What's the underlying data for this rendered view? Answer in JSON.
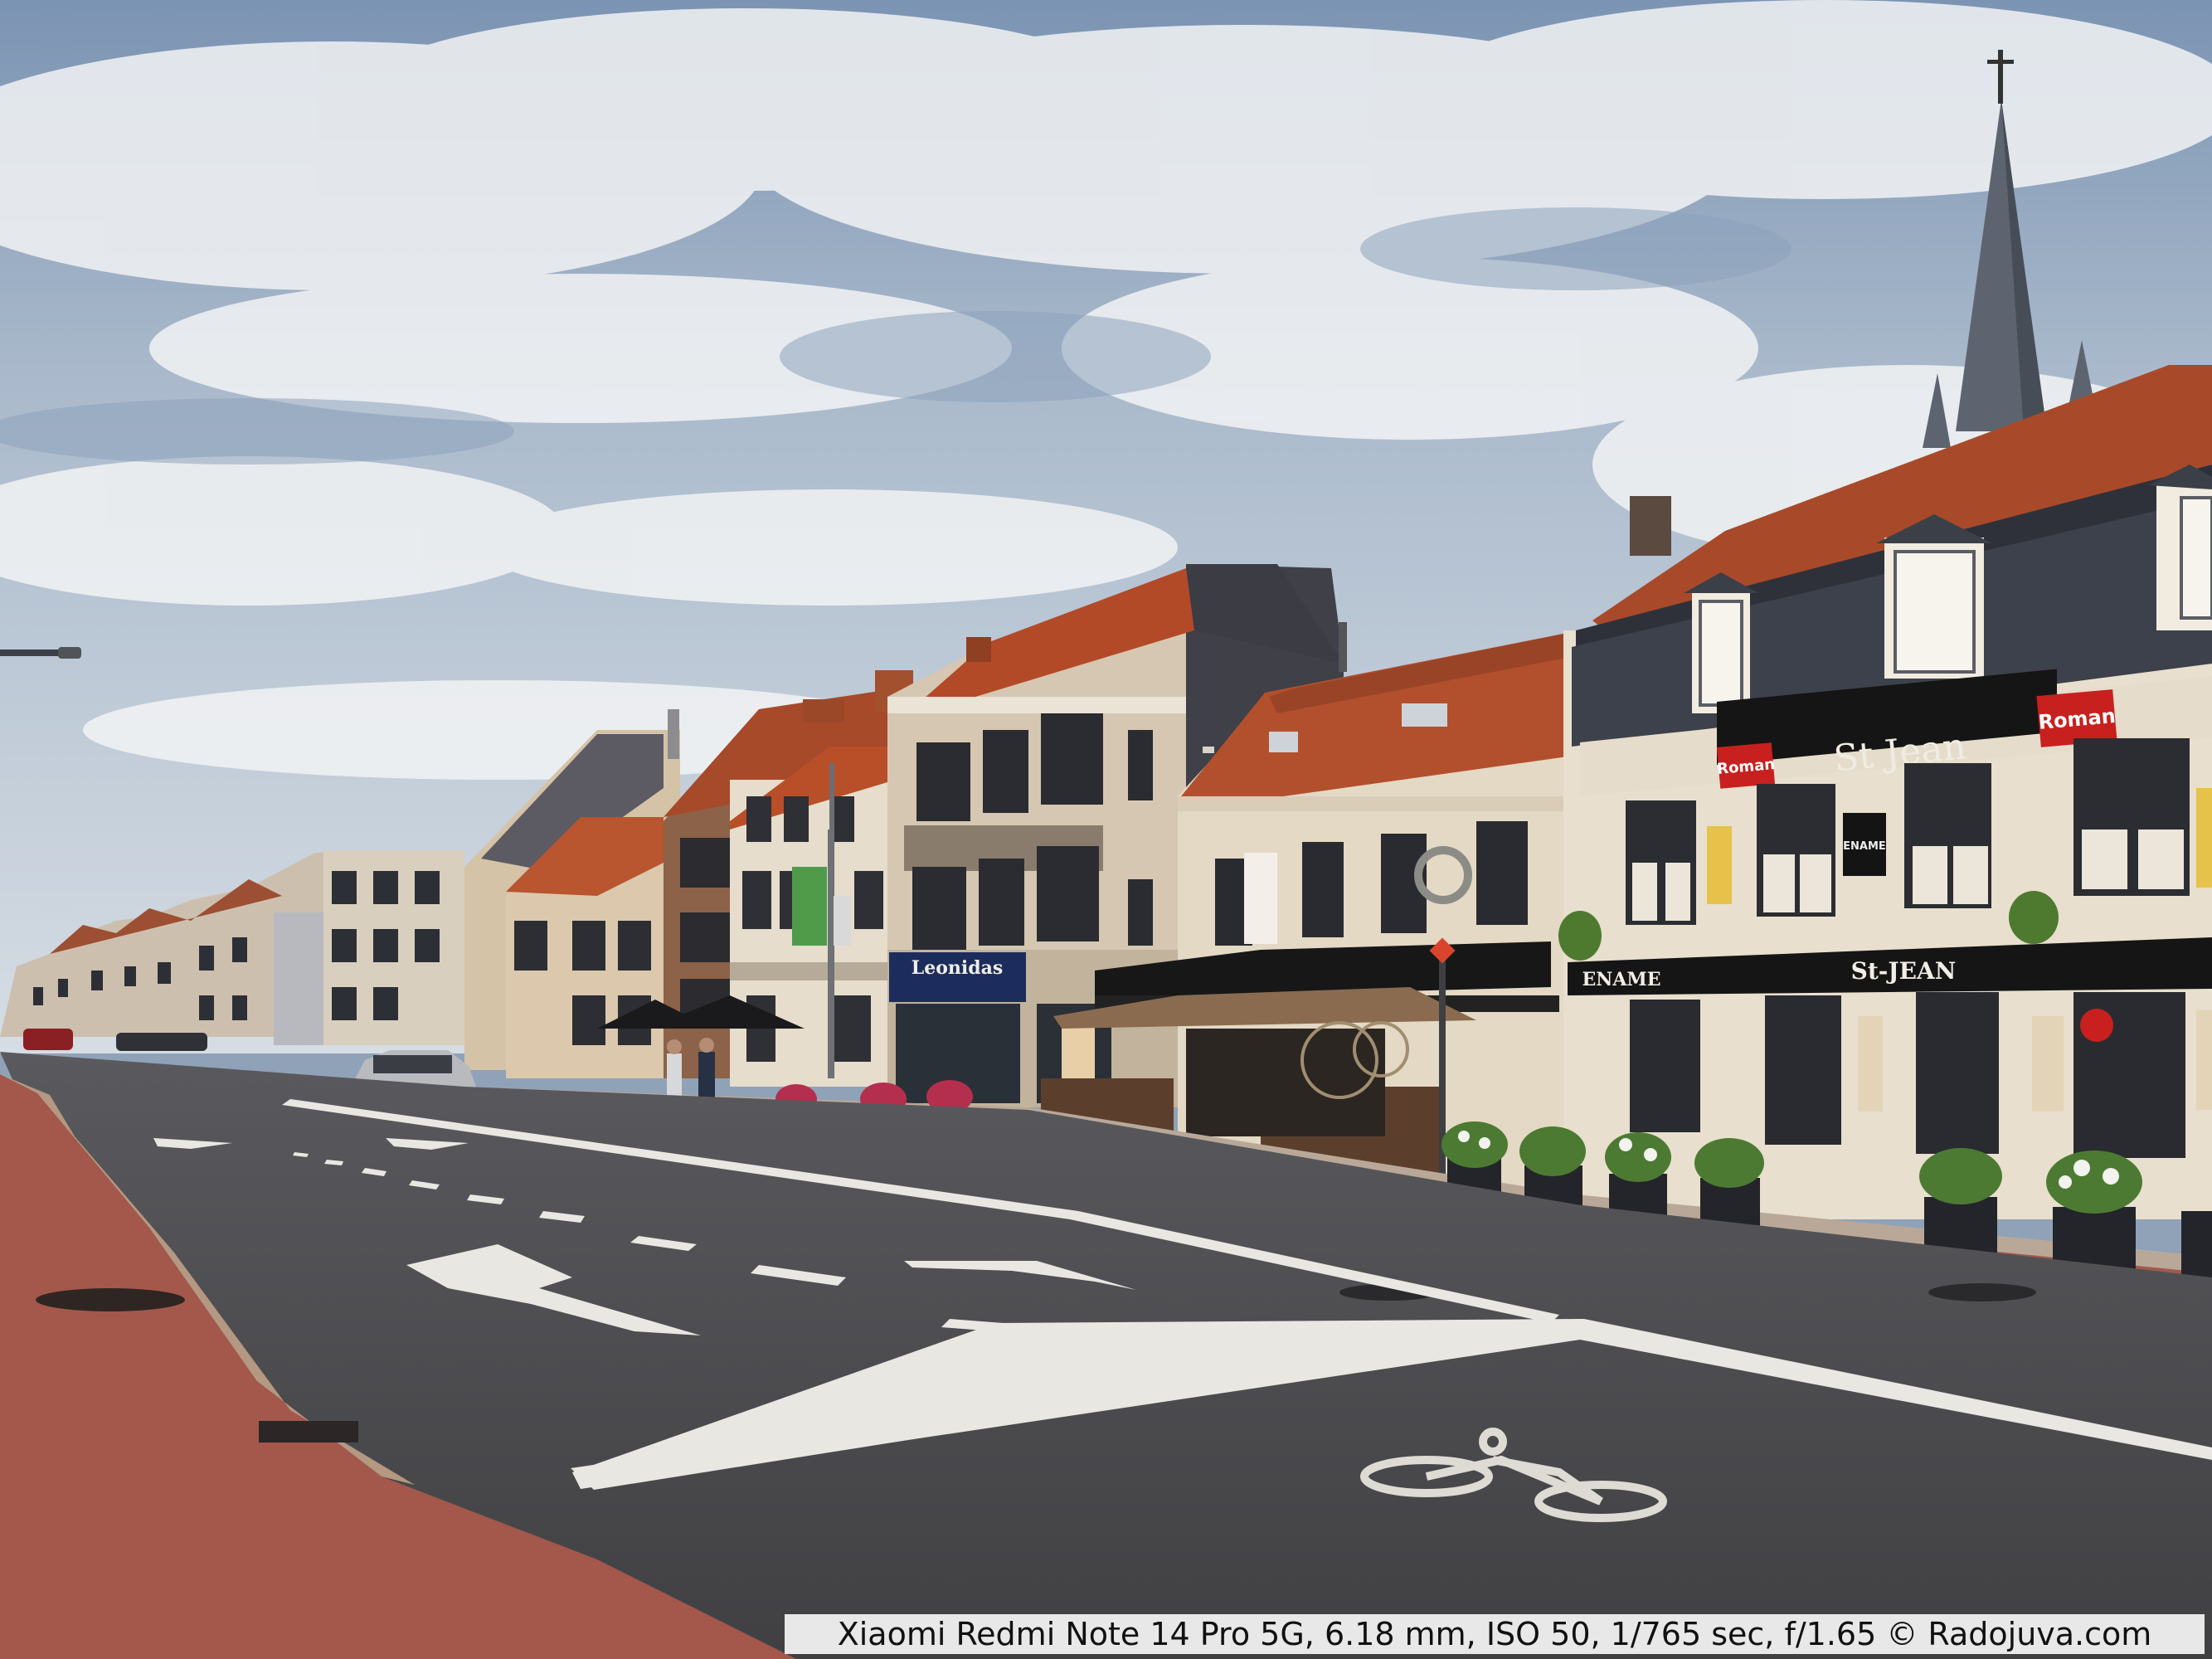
{
  "scene": {
    "signs": {
      "leonidas": "Leonidas",
      "st_jean_main": "St Jean",
      "st_jean_lower": "St-JEAN",
      "ename": "ENAME",
      "roman_left": "Roman",
      "roman_right": "Roman",
      "ename_round": "ENAME"
    },
    "colors": {
      "sky_top": "#5e7fa8",
      "sky_bottom": "#c9d3dd",
      "road": "#4a4a4d",
      "bike_lane": "#a5574c",
      "sidewalk_tile": "#b9a699",
      "roof_tile": "#a24a2c",
      "slate": "#404654",
      "facade_cream": "#e6dccb",
      "facade_beige": "#cfc0ab",
      "facade_white": "#efe8dd",
      "sign_black": "#151515",
      "sign_red": "#c8201e",
      "sign_navy": "#1c2c5c"
    }
  },
  "caption": {
    "text": "Xiaomi Redmi Note 14 Pro 5G, 6.18 mm, ISO 50, 1/765 sec, f/1.65 © Radojuva.com"
  }
}
